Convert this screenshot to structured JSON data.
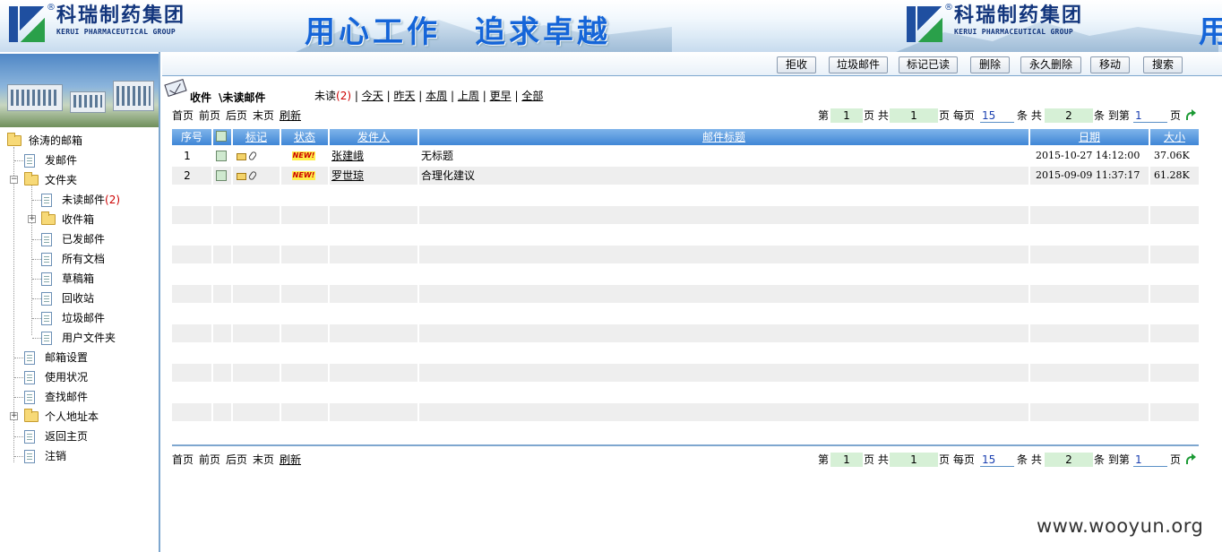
{
  "banner": {
    "brand_cn": "科瑞制药集团",
    "brand_en": "KERUI PHARMACEUTICAL GROUP",
    "slogan": "用心工作　追求卓越",
    "slogan_fragment": "用"
  },
  "sidebar": {
    "root": "徐涛的邮箱",
    "items": {
      "compose": "发邮件",
      "folders": "文件夹",
      "unread": "未读邮件",
      "unread_count": "(2)",
      "inbox": "收件箱",
      "sent": "已发邮件",
      "all_docs": "所有文档",
      "drafts": "草稿箱",
      "recycle": "回收站",
      "junk": "垃圾邮件",
      "user_folders": "用户文件夹",
      "settings": "邮箱设置",
      "usage": "使用状况",
      "find": "查找邮件",
      "address_book": "个人地址本",
      "home": "返回主页",
      "logout": "注销"
    }
  },
  "toolbar": {
    "reject": "拒收",
    "junk": "垃圾邮件",
    "mark_read": "标记已读",
    "delete": "删除",
    "delete_forever": "永久删除",
    "move": "移动",
    "search": "搜索"
  },
  "crumb": {
    "inbox": "收件",
    "current": "\\未读邮件"
  },
  "filters": {
    "unread": "未读",
    "unread_count": "(2)",
    "today": "今天",
    "yesterday": "昨天",
    "this_week": "本周",
    "last_week": "上周",
    "earlier": "更早",
    "all": "全部",
    "sep": "|"
  },
  "pager": {
    "first": "首页",
    "prev": "前页",
    "next": "后页",
    "last": "末页",
    "refresh": "刷新",
    "page_prefix": "第",
    "current_page": "1",
    "page_suffix": "页 共",
    "total_pages": "1",
    "per_page_prefix": "页 每页",
    "per_page": "15",
    "count_prefix": "条 共",
    "total": "2",
    "goto_prefix": "条 到第",
    "goto_page": "1",
    "goto_suffix": "页"
  },
  "table": {
    "headers": {
      "seq": "序号",
      "mark": "标记",
      "status": "状态",
      "sender": "发件人",
      "subject": "邮件标题",
      "date": "日期",
      "size": "大小"
    },
    "rows": [
      {
        "seq": "1",
        "status": "NEW!",
        "sender": "张建峨",
        "subject": "无标题",
        "date": "2015-10-27 14:12:00",
        "size": "37.06K"
      },
      {
        "seq": "2",
        "status": "NEW!",
        "sender": "罗世琼",
        "subject": "合理化建议",
        "date": "2015-09-09 11:37:17",
        "size": "61.28K"
      }
    ]
  },
  "watermark": "www.wooyun.org",
  "colors": {
    "header_blue": "#3f86d6",
    "page_box_green": "#d6f0d6",
    "brand_blue": "#12357c"
  }
}
